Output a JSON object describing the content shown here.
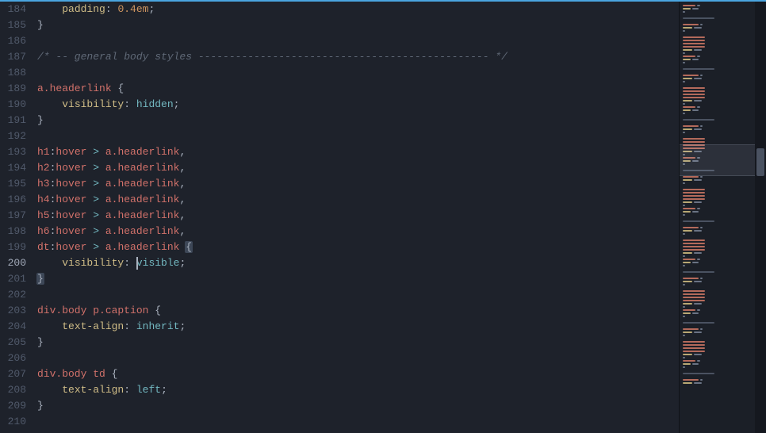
{
  "editor": {
    "startLine": 184,
    "activeLine": 200,
    "cursorCol": 17,
    "cursorText": "    visibility: ",
    "lines": [
      {
        "num": 184,
        "tokens": [
          [
            "space",
            "    "
          ],
          [
            "property",
            "padding"
          ],
          [
            "punct",
            ": "
          ],
          [
            "number",
            "0.4em"
          ],
          [
            "punct",
            ";"
          ]
        ]
      },
      {
        "num": 185,
        "tokens": [
          [
            "punct",
            "}"
          ]
        ]
      },
      {
        "num": 186,
        "tokens": []
      },
      {
        "num": 187,
        "tokens": [
          [
            "comment",
            "/* -- general body styles ----------------------------------------------- */"
          ]
        ]
      },
      {
        "num": 188,
        "tokens": []
      },
      {
        "num": 189,
        "tokens": [
          [
            "selector",
            "a.headerlink"
          ],
          [
            "punct",
            " {"
          ]
        ]
      },
      {
        "num": 190,
        "tokens": [
          [
            "space",
            "    "
          ],
          [
            "property",
            "visibility"
          ],
          [
            "punct",
            ": "
          ],
          [
            "valuekey",
            "hidden"
          ],
          [
            "punct",
            ";"
          ]
        ]
      },
      {
        "num": 191,
        "tokens": [
          [
            "punct",
            "}"
          ]
        ]
      },
      {
        "num": 192,
        "tokens": []
      },
      {
        "num": 193,
        "tokens": [
          [
            "selector",
            "h1"
          ],
          [
            "punct",
            ":"
          ],
          [
            "pseudo",
            "hover"
          ],
          [
            "operator",
            " > "
          ],
          [
            "selector",
            "a.headerlink"
          ],
          [
            "punct",
            ","
          ]
        ]
      },
      {
        "num": 194,
        "tokens": [
          [
            "selector",
            "h2"
          ],
          [
            "punct",
            ":"
          ],
          [
            "pseudo",
            "hover"
          ],
          [
            "operator",
            " > "
          ],
          [
            "selector",
            "a.headerlink"
          ],
          [
            "punct",
            ","
          ]
        ]
      },
      {
        "num": 195,
        "tokens": [
          [
            "selector",
            "h3"
          ],
          [
            "punct",
            ":"
          ],
          [
            "pseudo",
            "hover"
          ],
          [
            "operator",
            " > "
          ],
          [
            "selector",
            "a.headerlink"
          ],
          [
            "punct",
            ","
          ]
        ]
      },
      {
        "num": 196,
        "tokens": [
          [
            "selector",
            "h4"
          ],
          [
            "punct",
            ":"
          ],
          [
            "pseudo",
            "hover"
          ],
          [
            "operator",
            " > "
          ],
          [
            "selector",
            "a.headerlink"
          ],
          [
            "punct",
            ","
          ]
        ]
      },
      {
        "num": 197,
        "tokens": [
          [
            "selector",
            "h5"
          ],
          [
            "punct",
            ":"
          ],
          [
            "pseudo",
            "hover"
          ],
          [
            "operator",
            " > "
          ],
          [
            "selector",
            "a.headerlink"
          ],
          [
            "punct",
            ","
          ]
        ]
      },
      {
        "num": 198,
        "tokens": [
          [
            "selector",
            "h6"
          ],
          [
            "punct",
            ":"
          ],
          [
            "pseudo",
            "hover"
          ],
          [
            "operator",
            " > "
          ],
          [
            "selector",
            "a.headerlink"
          ],
          [
            "punct",
            ","
          ]
        ]
      },
      {
        "num": 199,
        "tokens": [
          [
            "selector",
            "dt"
          ],
          [
            "punct",
            ":"
          ],
          [
            "pseudo",
            "hover"
          ],
          [
            "operator",
            " > "
          ],
          [
            "selector",
            "a.headerlink"
          ],
          [
            "punct",
            " "
          ],
          [
            "bracket",
            "{"
          ]
        ]
      },
      {
        "num": 200,
        "highlight": true,
        "tokens": [
          [
            "space",
            "    "
          ],
          [
            "property",
            "visibility"
          ],
          [
            "punct",
            ": "
          ],
          [
            "valuekey",
            "visible"
          ],
          [
            "punct",
            ";"
          ]
        ]
      },
      {
        "num": 201,
        "tokens": [
          [
            "bracket",
            "}"
          ]
        ]
      },
      {
        "num": 202,
        "tokens": []
      },
      {
        "num": 203,
        "tokens": [
          [
            "selector",
            "div.body p.caption"
          ],
          [
            "punct",
            " {"
          ]
        ]
      },
      {
        "num": 204,
        "tokens": [
          [
            "space",
            "    "
          ],
          [
            "property",
            "text-align"
          ],
          [
            "punct",
            ": "
          ],
          [
            "valuekey",
            "inherit"
          ],
          [
            "punct",
            ";"
          ]
        ]
      },
      {
        "num": 205,
        "tokens": [
          [
            "punct",
            "}"
          ]
        ]
      },
      {
        "num": 206,
        "tokens": []
      },
      {
        "num": 207,
        "tokens": [
          [
            "selector",
            "div.body td"
          ],
          [
            "punct",
            " {"
          ]
        ]
      },
      {
        "num": 208,
        "tokens": [
          [
            "space",
            "    "
          ],
          [
            "property",
            "text-align"
          ],
          [
            "punct",
            ": "
          ],
          [
            "valuekey",
            "left"
          ],
          [
            "punct",
            ";"
          ]
        ]
      },
      {
        "num": 209,
        "tokens": [
          [
            "punct",
            "}"
          ]
        ]
      },
      {
        "num": 210,
        "tokens": []
      }
    ]
  },
  "minimap": {
    "viewportTop": 180,
    "viewportHeight": 40,
    "scrollThumbTop": 185,
    "scrollThumbHeight": 35
  }
}
